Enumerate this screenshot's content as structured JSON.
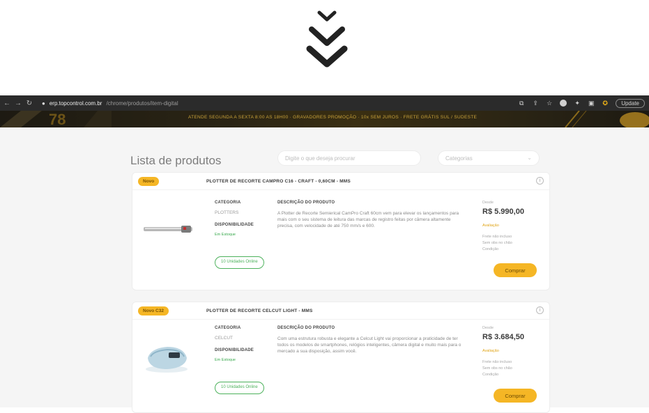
{
  "browser": {
    "domain": "erp.topcontrol.com.br",
    "path": "/chrome/produtos/item-digital",
    "update_label": "Update"
  },
  "banner": {
    "text": "ATENDE SEGUNDA A SEXTA 8:00 AS 18H00 · GRAVADORES PROMOÇÃO · 10x SEM JUROS · FRETE GRÁTIS SUL / SUDESTE"
  },
  "header": {
    "title": "Lista de produtos",
    "search_placeholder": "Digite o que deseja procurar",
    "category_placeholder": "Categorias"
  },
  "products": [
    {
      "badge": "Novo",
      "title": "PLOTTER DE RECORTE CAMPRO C16 - CRAFT - 0,60CM - MMS",
      "category_label": "CATEGORIA",
      "category": "PLOTTERS",
      "availability_label": "DISPONIBILIDADE",
      "availability": "Em Estoque",
      "stock_button": "10 Unidades Online",
      "description_label": "DESCRIÇÃO DO PRODUTO",
      "description": "A Plotter de Recorte Semierical CamPro Craft 60cm vem para elevar os lançamentos para mais com o seu sistema de leitura das marcas de registro feitas por câmera altamente precisa, com velocidade de até 750 mm/s e 600.",
      "price_from": "Desde",
      "price": "R$ 5.990,00",
      "price_note": "Avaliação",
      "note_lines": [
        "Frete não incluso",
        "Sem obs no chão",
        "Condição"
      ],
      "buy_label": "Comprar"
    },
    {
      "badge": "Novo C32",
      "title": "PLOTTER DE RECORTE CELCUT LIGHT - MMS",
      "category_label": "CATEGORIA",
      "category": "CELCUT",
      "availability_label": "DISPONIBILIDADE",
      "availability": "Em Estoque",
      "stock_button": "10 Unidades Online",
      "description_label": "DESCRIÇÃO DO PRODUTO",
      "description": "Com uma estrutura robusta e elegante a Celcut Light vai proporcionar a praticidade de ter todos os modelos de smartphones, relógios inteligentes, câmera digital e muito mais para o mercado a sua disposição, assim você.",
      "price_from": "Desde",
      "price": "R$ 3.684,50",
      "price_note": "Avaliação",
      "note_lines": [
        "Frete não incluso",
        "Sem obs no chão",
        "Condição"
      ],
      "buy_label": "Comprar"
    }
  ],
  "colors": {
    "accent": "#f5b625",
    "green": "#4cb15b",
    "browser_bar": "#2b2b2b"
  }
}
